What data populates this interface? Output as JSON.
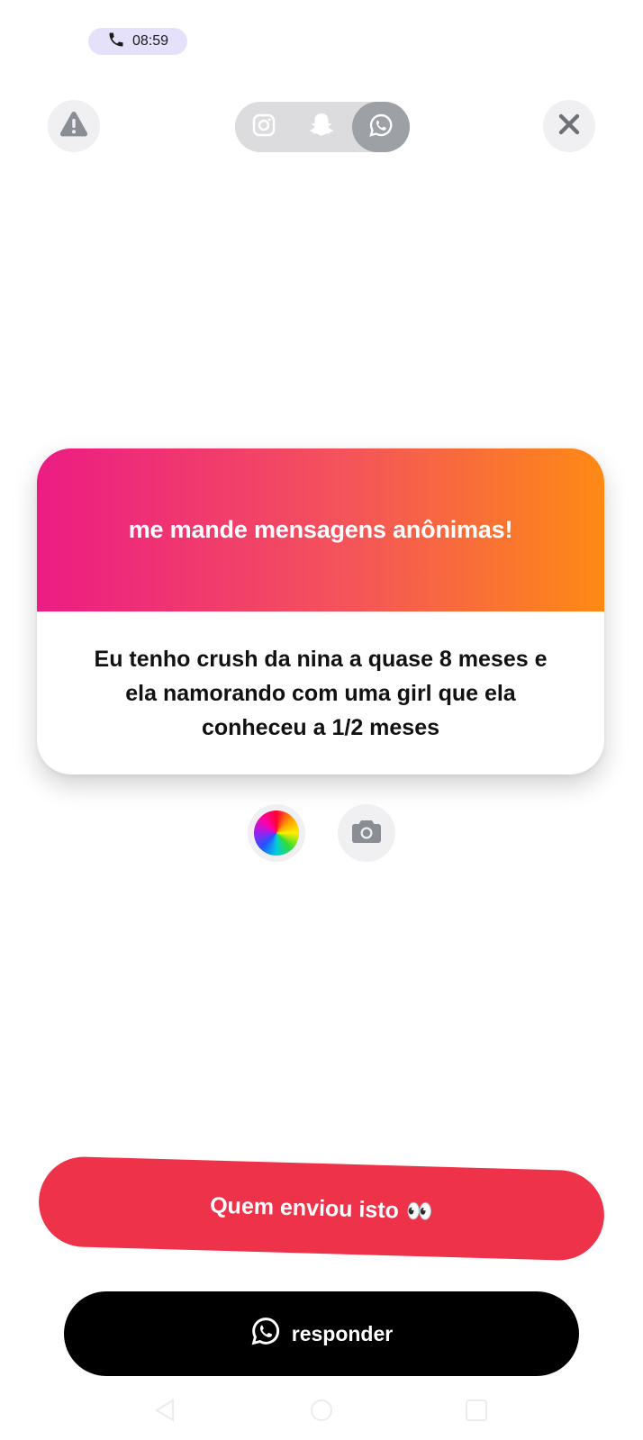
{
  "status_bar": {
    "call_time": "08:59",
    "call_icon": "phone-icon"
  },
  "top_bar": {
    "report_icon": "warning-icon",
    "close_icon": "close-icon",
    "platforms": [
      {
        "name": "instagram",
        "icon": "instagram-icon",
        "selected": false
      },
      {
        "name": "snapchat",
        "icon": "snapchat-icon",
        "selected": false
      },
      {
        "name": "whatsapp",
        "icon": "whatsapp-icon",
        "selected": true
      }
    ]
  },
  "card": {
    "title": "me mande mensagens anônimas!",
    "message": "Eu tenho crush da nina a quase 8 meses e ela namorando com uma girl que ela conheceu a 1/2 meses",
    "gradient_colors": [
      "#ec1c84",
      "#f4545a",
      "#fe8a14"
    ]
  },
  "tools": {
    "color_icon": "color-wheel-icon",
    "camera_icon": "camera-icon"
  },
  "actions": {
    "who_sent_label": "Quem enviou isto",
    "who_sent_emoji": "👀",
    "who_sent_color": "#ee3249",
    "reply_label": "responder",
    "reply_icon": "whatsapp-icon"
  },
  "nav": {
    "back_icon": "back-triangle-icon",
    "home_icon": "home-circle-icon",
    "recent_icon": "recent-square-icon"
  }
}
